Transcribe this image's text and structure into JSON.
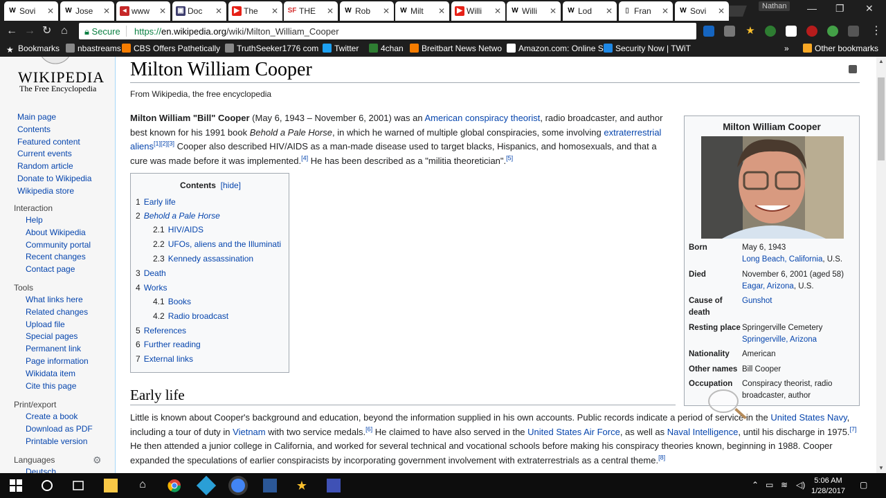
{
  "browser": {
    "tabs": [
      {
        "label": "Sovi",
        "fav": "W",
        "color": "#ffffff",
        "fg": "#000"
      },
      {
        "label": "Jose",
        "fav": "W",
        "color": "#ffffff",
        "fg": "#000"
      },
      {
        "label": "www",
        "fav": "◂",
        "color": "#c62828",
        "fg": "#fff"
      },
      {
        "label": "Doc",
        "fav": "▣",
        "color": "#3e3e6e",
        "fg": "#fff"
      },
      {
        "label": "The",
        "fav": "▶",
        "color": "#e62117",
        "fg": "#fff"
      },
      {
        "label": "THE",
        "fav": "SF",
        "color": "#ffffff",
        "fg": "#d32f2f"
      },
      {
        "label": "Rob",
        "fav": "W",
        "color": "#ffffff",
        "fg": "#000"
      },
      {
        "label": "Milt",
        "fav": "W",
        "color": "#ffffff",
        "fg": "#000"
      },
      {
        "label": "Willi",
        "fav": "▶",
        "color": "#e62117",
        "fg": "#fff"
      },
      {
        "label": "Willi",
        "fav": "W",
        "color": "#ffffff",
        "fg": "#000"
      },
      {
        "label": "Lod",
        "fav": "W",
        "color": "#ffffff",
        "fg": "#000"
      },
      {
        "label": "Fran",
        "fav": "▯",
        "color": "#ffffff",
        "fg": "#555"
      },
      {
        "label": "Sovi",
        "fav": "W",
        "color": "#ffffff",
        "fg": "#000"
      }
    ],
    "user": "Nathan",
    "secure_label": "Secure",
    "url_scheme": "https://",
    "url_host": "en.wikipedia.org",
    "url_path": "/wiki/Milton_William_Cooper",
    "bookmarks": [
      {
        "label": "Bookmarks",
        "icon": "star",
        "color": "#ffffff"
      },
      {
        "label": "nbastreams",
        "icon": "site",
        "color": "#888888"
      },
      {
        "label": "CBS Offers Pathetically",
        "icon": "blogger",
        "color": "#f57c00"
      },
      {
        "label": "TruthSeeker1776 com",
        "icon": "site",
        "color": "#888888"
      },
      {
        "label": "Twitter",
        "icon": "twitter",
        "color": "#1da1f2"
      },
      {
        "label": "4chan",
        "icon": "clover",
        "color": "#2e7d32"
      },
      {
        "label": "Breitbart News Netwo",
        "icon": "blogger",
        "color": "#f57c00"
      },
      {
        "label": "Amazon.com: Online S",
        "icon": "amazon",
        "color": "#ffffff"
      },
      {
        "label": "Security Now | TWiT",
        "icon": "globe",
        "color": "#1e88e5"
      }
    ],
    "other_bookmarks": "Other bookmarks"
  },
  "sidebar": {
    "logo_word": "WIKIPEDIA",
    "logo_tag": "The Free Encyclopedia",
    "nav": [
      "Main page",
      "Contents",
      "Featured content",
      "Current events",
      "Random article",
      "Donate to Wikipedia",
      "Wikipedia store"
    ],
    "interaction_heading": "Interaction",
    "interaction": [
      "Help",
      "About Wikipedia",
      "Community portal",
      "Recent changes",
      "Contact page"
    ],
    "tools_heading": "Tools",
    "tools": [
      "What links here",
      "Related changes",
      "Upload file",
      "Special pages",
      "Permanent link",
      "Page information",
      "Wikidata item",
      "Cite this page"
    ],
    "print_heading": "Print/export",
    "print": [
      "Create a book",
      "Download as PDF",
      "Printable version"
    ],
    "languages_heading": "Languages",
    "languages": [
      "Deutsch"
    ]
  },
  "article": {
    "title": "Milton William Cooper",
    "site_sub": "From Wikipedia, the free encyclopedia",
    "toc_title": "Contents",
    "toc_hide": "[hide]",
    "toc": [
      {
        "num": "1",
        "label": "Early life",
        "level": 1,
        "italic": false
      },
      {
        "num": "2",
        "label": "Behold a Pale Horse",
        "level": 1,
        "italic": true
      },
      {
        "num": "2.1",
        "label": "HIV/AIDS",
        "level": 2,
        "italic": false
      },
      {
        "num": "2.2",
        "label": "UFOs, aliens and the Illuminati",
        "level": 2,
        "italic": false
      },
      {
        "num": "2.3",
        "label": "Kennedy assassination",
        "level": 2,
        "italic": false
      },
      {
        "num": "3",
        "label": "Death",
        "level": 1,
        "italic": false
      },
      {
        "num": "4",
        "label": "Works",
        "level": 1,
        "italic": false
      },
      {
        "num": "4.1",
        "label": "Books",
        "level": 2,
        "italic": false
      },
      {
        "num": "4.2",
        "label": "Radio broadcast",
        "level": 2,
        "italic": false
      },
      {
        "num": "5",
        "label": "References",
        "level": 1,
        "italic": false
      },
      {
        "num": "6",
        "label": "Further reading",
        "level": 1,
        "italic": false
      },
      {
        "num": "7",
        "label": "External links",
        "level": 1,
        "italic": false
      }
    ],
    "lead": {
      "name_bold": "Milton William \"Bill\" Cooper",
      "t1": " (May 6, 1943 – November 6, 2001) was an ",
      "link1": "American conspiracy theorist",
      "t2": ", radio broadcaster, and author best known for his 1991 book ",
      "book": "Behold a Pale Horse",
      "t3": ", in which he warned of multiple global conspiracies, some involving ",
      "link2": "extraterrestrial aliens",
      "ref1": "[1][2][3]",
      "t4": " Cooper also described HIV/AIDS as a man-made disease used to target blacks, Hispanics, and homosexuals, and that a cure was made before it was implemented.",
      "ref2": "[4]",
      "t5": " He has been described as a \"militia theoretician\".",
      "ref3": "[5]"
    },
    "section1_title": "Early life",
    "section1": {
      "t1": "Little is known about Cooper's background and education, beyond the information supplied in his own accounts. Public records indicate a period of service in the ",
      "link1": "United States Navy",
      "t2": ", including a tour of duty in ",
      "link2": "Vietnam",
      "t3": " with two service medals.",
      "ref1": "[6]",
      "t4": " He claimed to have also served in the ",
      "link3": "United States Air Force",
      "t5": ", as well as ",
      "link4": "Naval Intelligence",
      "t6": ", until his discharge in 1975.",
      "ref2": "[7]",
      "t7": " He then attended a junior college in California, and worked for several technical and vocational schools before making his conspiracy theories known, beginning in 1988. Cooper expanded the speculations of earlier conspiracists by incorporating government involvement with extraterrestrials as a central theme.",
      "ref3": "[8]"
    }
  },
  "infobox": {
    "title": "Milton William Cooper",
    "rows": [
      {
        "k": "Born",
        "v1": "May 6, 1943",
        "v2_link": "Long Beach, California",
        "v2_tail": ", U.S."
      },
      {
        "k": "Died",
        "v1": "November 6, 2001 (aged 58)",
        "v2_link": "Eagar, Arizona",
        "v2_tail": ", U.S."
      },
      {
        "k": "Cause of death",
        "v1": "",
        "v2_link": "Gunshot",
        "v2_tail": ""
      },
      {
        "k": "Resting place",
        "v1": "Springerville Cemetery",
        "v2_link": "Springerville, Arizona",
        "v2_tail": ""
      },
      {
        "k": "Nationality",
        "v1": "American",
        "v2_link": "",
        "v2_tail": ""
      },
      {
        "k": "Other names",
        "v1": "Bill Cooper",
        "v2_link": "",
        "v2_tail": ""
      },
      {
        "k": "Occupation",
        "v1": "Conspiracy theorist, radio broadcaster, author",
        "v2_link": "",
        "v2_tail": ""
      }
    ]
  },
  "taskbar": {
    "time": "5:06 AM",
    "date": "1/28/2017"
  },
  "colors": {
    "link": "#0645ad",
    "chrome": "#1e1e1e",
    "secure": "#0b8043"
  }
}
